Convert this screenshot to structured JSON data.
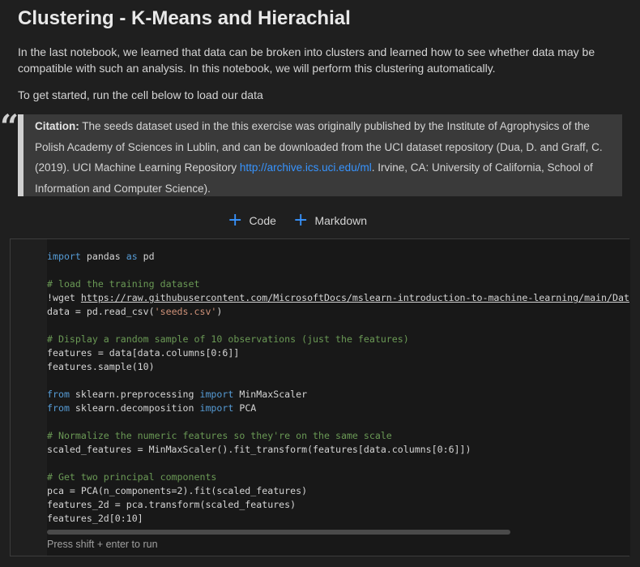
{
  "notebook": {
    "title": "Clustering - K-Means and Hierachial",
    "intro": "In the last notebook, we learned that data can be broken into clusters and learned how to see whether data may be compatible with such an analysis. In this notebook, we will perform this clustering automatically.",
    "instruction": "To get started, run the cell below to load our data",
    "quote_mark": "“",
    "citation": {
      "label": "Citation:",
      "text_before": " The seeds dataset used in the this exercise was originally published by the Institute of Agrophysics of the Polish Academy of Sciences in Lublin, and can be downloaded from the UCI dataset repository (Dua, D. and Graff, C. (2019). UCI Machine Learning Repository ",
      "link_text": "http://archive.ics.uci.edu/ml",
      "text_after": ". Irvine, CA: University of California, School of Information and Computer Science)."
    }
  },
  "add_cell": {
    "code_label": "Code",
    "markdown_label": "Markdown",
    "plus_symbol": "+"
  },
  "code_cell": {
    "lines": [
      "import pandas as pd",
      "",
      "# load the training dataset",
      "!wget https://raw.githubusercontent.com/MicrosoftDocs/mslearn-introduction-to-machine-learning/main/Dat",
      "data = pd.read_csv('seeds.csv')",
      "",
      "# Display a random sample of 10 observations (just the features)",
      "features = data[data.columns[0:6]]",
      "features.sample(10)",
      "",
      "from sklearn.preprocessing import MinMaxScaler",
      "from sklearn.decomposition import PCA",
      "",
      "# Normalize the numeric features so they're on the same scale",
      "scaled_features = MinMaxScaler().fit_transform(features[data.columns[0:6]])",
      "",
      "# Get two principal components",
      "pca = PCA(n_components=2).fit(scaled_features)",
      "features_2d = pca.transform(scaled_features)",
      "features_2d[0:10]"
    ],
    "run_hint": "Press shift + enter to run"
  },
  "colors": {
    "background": "#1f1f1f",
    "editor_background": "#181818",
    "keyword": "#569cd6",
    "comment": "#6a9955",
    "string": "#ce9178",
    "link": "#3794ff",
    "citation_background": "#3a3a3a"
  }
}
